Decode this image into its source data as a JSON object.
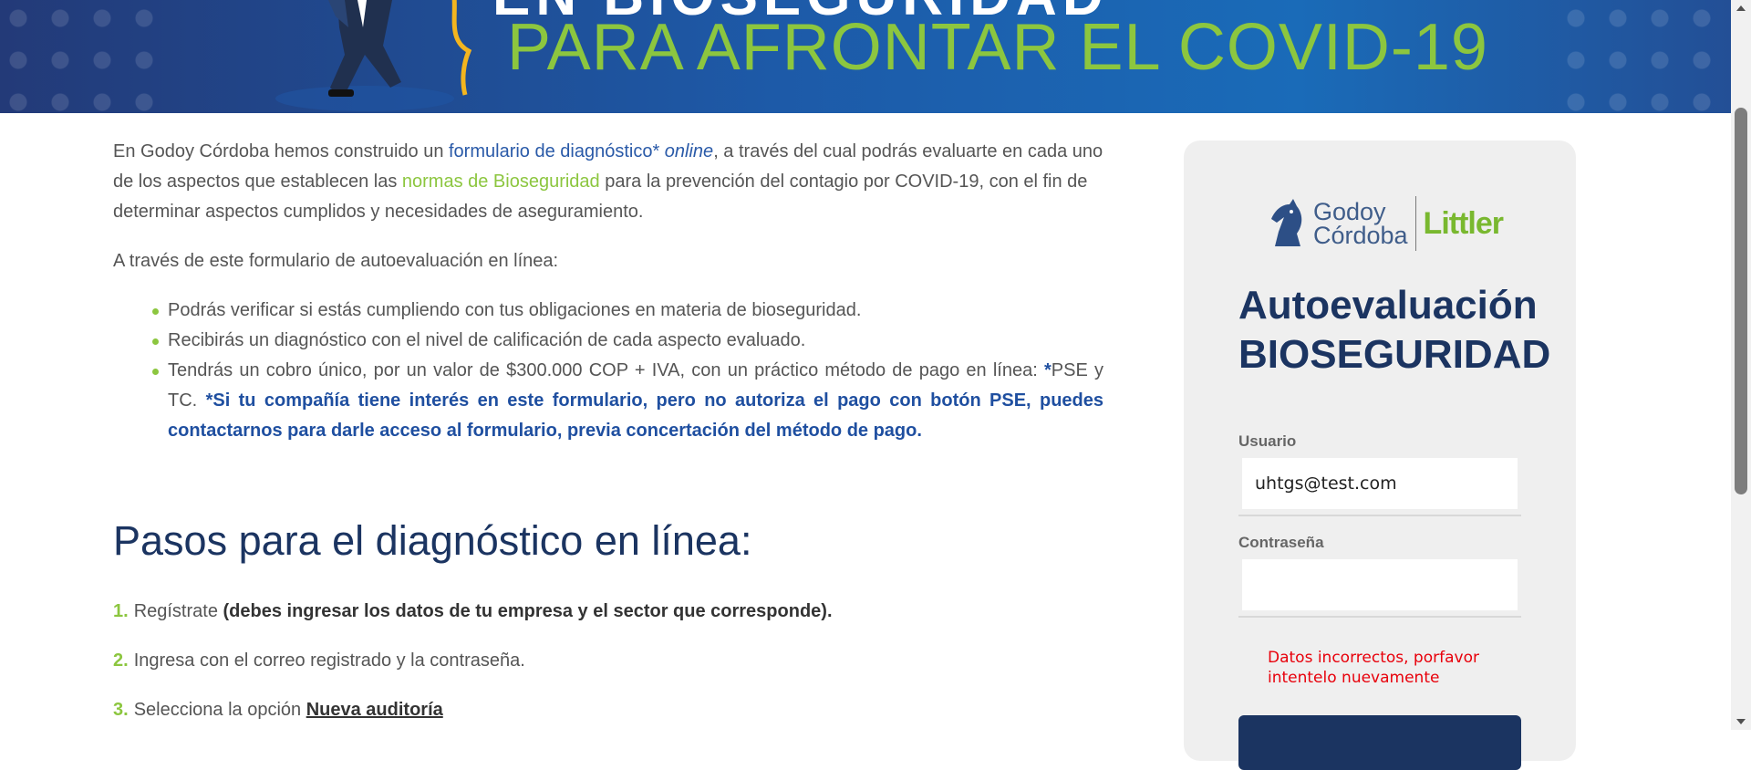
{
  "banner": {
    "top_line": "EN BIOSEGURIDAD",
    "headline": "PARA AFRONTAR EL COVID-19"
  },
  "intro": {
    "part1": "En Godoy Córdoba hemos construido un ",
    "link1": "formulario de diagnóstico* ",
    "link1_italic": "online",
    "part2": ", a través del cual podrás evaluarte en cada uno de los aspectos que establecen las ",
    "link2": "normas de Bioseguridad",
    "part3": " para la prevención del contagio por COVID-19, con el fin de determinar aspectos cumplidos y necesidades de aseguramiento."
  },
  "lead": "A través de este formulario de autoevaluación en línea:",
  "bullets": [
    "Podrás verificar si estás cumpliendo con tus obligaciones en materia de bioseguridad.",
    "Recibirás un diagnóstico con el nivel de calificación de cada aspecto evaluado."
  ],
  "bullet3": {
    "text": "Tendrás un cobro único, por un valor de $300.000 COP + IVA, con un práctico método de pago en línea: ",
    "star": "*",
    "pse": "PSE y TC. ",
    "note": "*Si tu compañía tiene interés en este formulario, pero no autoriza el pago con botón PSE, puedes contactarnos para darle acceso al formulario, previa concertación del método de pago."
  },
  "steps_title": "Pasos para el diagnóstico en línea:",
  "steps": [
    {
      "num": "1.",
      "text": "Regístrate ",
      "bold": "(debes ingresar los datos de tu empresa y el sector que corresponde)."
    },
    {
      "num": "2.",
      "text": "Ingresa con el correo registrado y la contraseña.",
      "bold": ""
    },
    {
      "num": "3.",
      "text": "Selecciona la opción ",
      "link": "Nueva auditoría"
    }
  ],
  "panel": {
    "logo_godoy_line1": "Godoy",
    "logo_godoy_line2": "Córdoba",
    "logo_littler": "Littler",
    "title_line1": "Autoevaluación",
    "title_line2": "BIOSEGURIDAD",
    "user_label": "Usuario",
    "user_value": "uhtgs@test.com",
    "password_label": "Contraseña",
    "password_value": "",
    "error": "Datos incorrectos, porfavor intentelo nuevamente"
  },
  "colors": {
    "accent_green": "#8cc63f",
    "navy": "#1b3461",
    "link_blue": "#2a5aa8",
    "error_red": "#e8000b"
  }
}
